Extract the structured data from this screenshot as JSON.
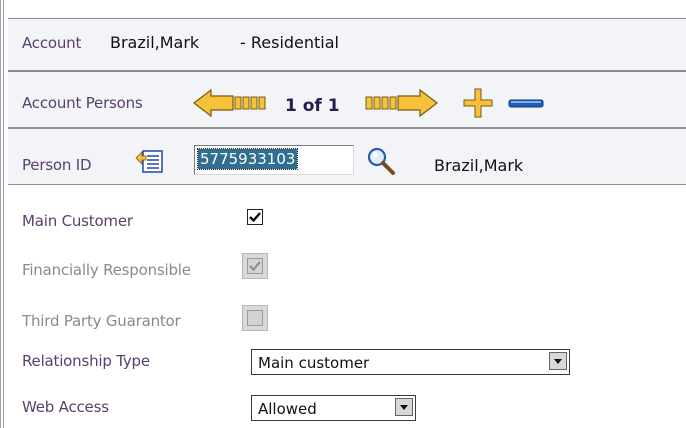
{
  "account": {
    "label": "Account",
    "name": "Brazil,Mark",
    "type": "- Residential"
  },
  "account_persons": {
    "label": "Account Persons",
    "counter": "1 of 1"
  },
  "person": {
    "id_label": "Person ID",
    "id_value": "5775933103",
    "name": "Brazil,Mark"
  },
  "fields": {
    "main_customer": {
      "label": "Main Customer",
      "checked": true
    },
    "financially_responsible": {
      "label": "Financially Responsible",
      "checked": true,
      "disabled": true
    },
    "third_party_guarantor": {
      "label": "Third Party Guarantor",
      "checked": false,
      "disabled": true
    },
    "relationship_type": {
      "label": "Relationship Type",
      "value": "Main customer"
    },
    "web_access": {
      "label": "Web Access",
      "value": "Allowed"
    }
  },
  "colors": {
    "label_text": "#5a3f6b",
    "arrow_fill": "#f6c23a",
    "minus_fill": "#1f5fb8",
    "selection_bg": "#2f6e8e"
  }
}
